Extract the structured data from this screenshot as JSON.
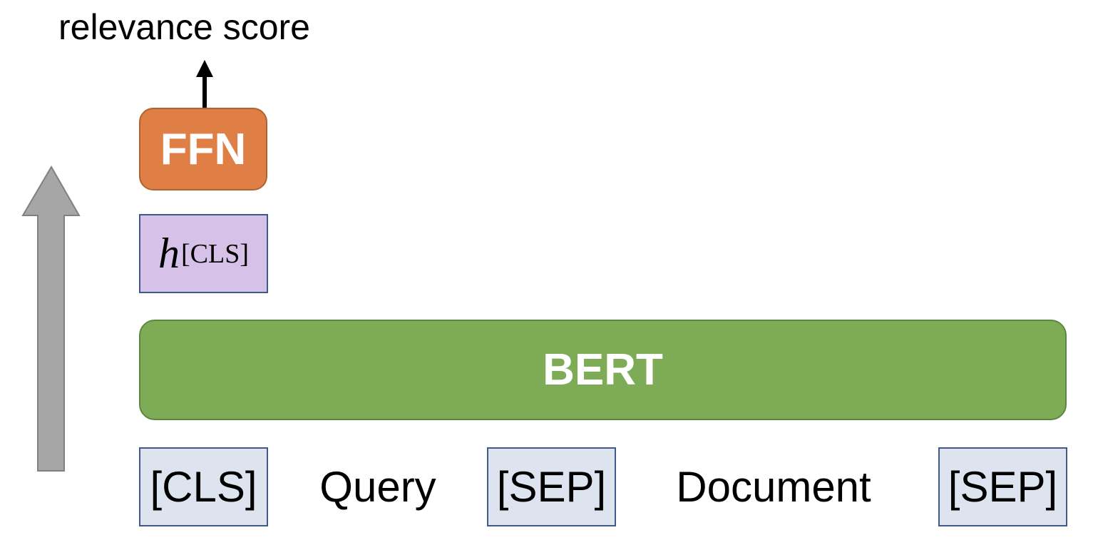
{
  "diagram": {
    "output_label": "relevance score",
    "ffn_label": "FFN",
    "hidden_state": {
      "symbol": "h",
      "subscript": "[CLS]"
    },
    "encoder_label": "BERT",
    "tokens": {
      "cls": "[CLS]",
      "query": "Query",
      "sep_1": "[SEP]",
      "document": "Document",
      "sep_2": "[SEP]"
    },
    "colors": {
      "ffn": "#e07f45",
      "hidden_state": "#d6c2e8",
      "encoder": "#7dab56",
      "token": "#dde3ef",
      "flow_arrow": "#a6a6a6"
    }
  }
}
